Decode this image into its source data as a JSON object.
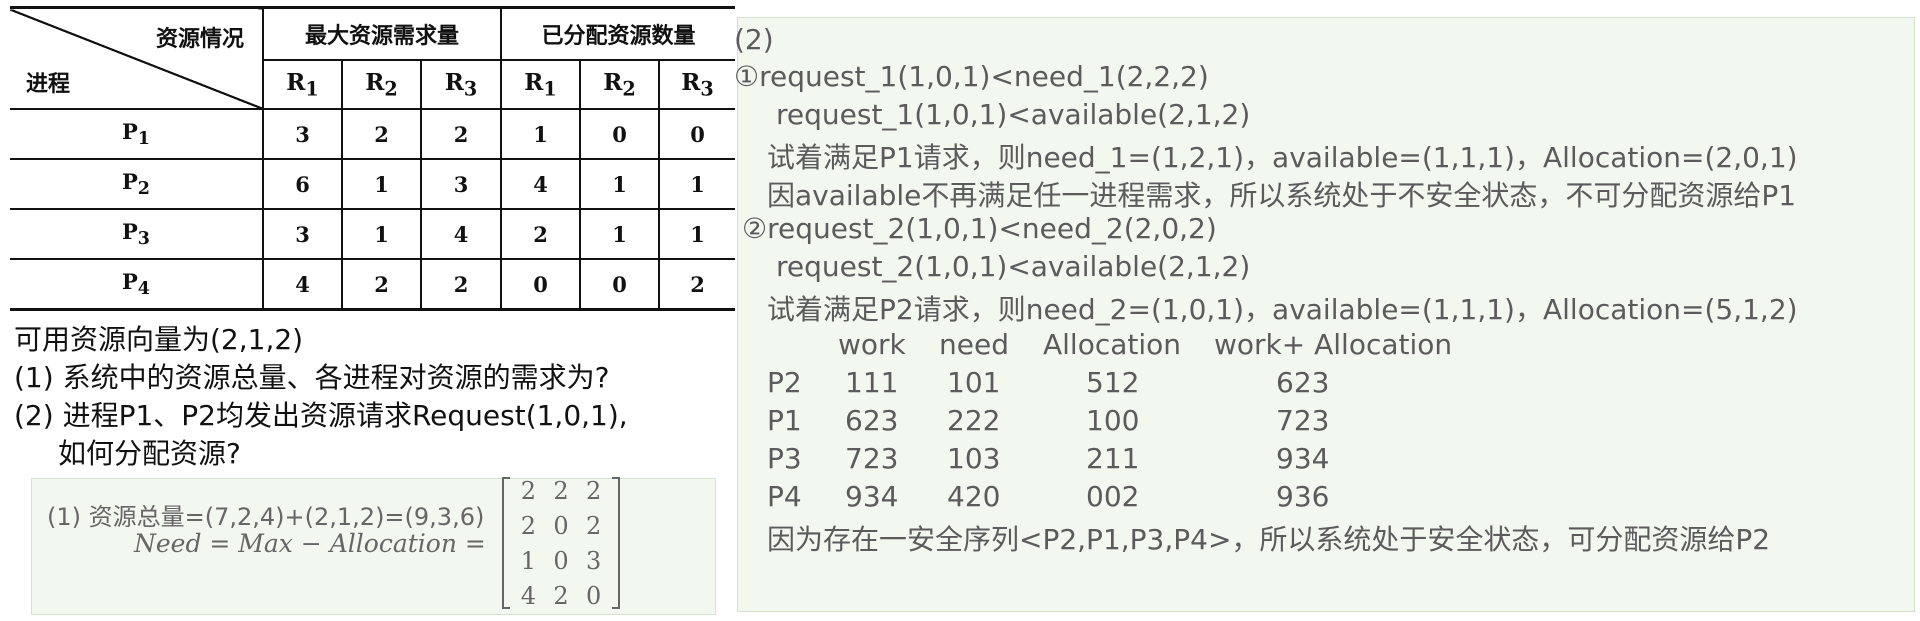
{
  "table": {
    "corner_top": "资源情况",
    "corner_bottom": "进程",
    "group_max": "最大资源需求量",
    "group_alloc": "已分配资源数量",
    "resources": [
      "R",
      "R",
      "R"
    ],
    "resource_subs": [
      "1",
      "2",
      "3"
    ],
    "rows": [
      {
        "proc": "P",
        "sub": "1",
        "max": [
          "3",
          "2",
          "2"
        ],
        "alloc": [
          "1",
          "0",
          "0"
        ]
      },
      {
        "proc": "P",
        "sub": "2",
        "max": [
          "6",
          "1",
          "3"
        ],
        "alloc": [
          "4",
          "1",
          "1"
        ]
      },
      {
        "proc": "P",
        "sub": "3",
        "max": [
          "3",
          "1",
          "4"
        ],
        "alloc": [
          "2",
          "1",
          "1"
        ]
      },
      {
        "proc": "P",
        "sub": "4",
        "max": [
          "4",
          "2",
          "2"
        ],
        "alloc": [
          "0",
          "0",
          "2"
        ]
      }
    ]
  },
  "question": {
    "available": "可用资源向量为(2,1,2)",
    "q1": "(1) 系统中的资源总量、各进程对资源的需求为?",
    "q2_a": "(2) 进程P1、P2均发出资源请求Request(1,0,1),",
    "q2_b": "如何分配资源?"
  },
  "answer1": {
    "line1": "(1)  资源总量=(7,2,4)+(2,1,2)=(9,3,6)",
    "line2": "Need = Max − Allocation =",
    "matrix": [
      [
        "2",
        "2",
        "2"
      ],
      [
        "2",
        "0",
        "2"
      ],
      [
        "1",
        "0",
        "3"
      ],
      [
        "4",
        "2",
        "0"
      ]
    ]
  },
  "answer2": {
    "heading": "(2)",
    "case1_a": "①request_1(1,0,1)<need_1(2,2,2)",
    "case1_b": "request_1(1,0,1)<available(2,1,2)",
    "case1_c": "试着满足P1请求，则need_1=(1,2,1)，available=(1,1,1)，Allocation=(2,0,1)",
    "case1_d": "因available不再满足任一进程需求，所以系统处于不安全状态，不可分配资源给P1",
    "case2_a": "②request_2(1,0,1)<need_2(2,0,2)",
    "case2_b": "request_2(1,0,1)<available(2,1,2)",
    "case2_c": "试着满足P2请求，则need_2=(1,0,1)，available=(1,1,1)，Allocation=(5,1,2)",
    "safety_headers": [
      "work",
      "need",
      "Allocation",
      "work+ Allocation"
    ],
    "safety_rows": [
      {
        "proc": "P2",
        "work": "111",
        "need": "101",
        "alloc": "512",
        "sum": "623"
      },
      {
        "proc": "P1",
        "work": "623",
        "need": "222",
        "alloc": "100",
        "sum": "723"
      },
      {
        "proc": "P3",
        "work": "723",
        "need": "103",
        "alloc": "211",
        "sum": "934"
      },
      {
        "proc": "P4",
        "work": "934",
        "need": "420",
        "alloc": "002",
        "sum": "936"
      }
    ],
    "conclusion": "因为存在一安全序列<P2,P1,P3,P4>，所以系统处于安全状态，可分配资源给P2"
  }
}
